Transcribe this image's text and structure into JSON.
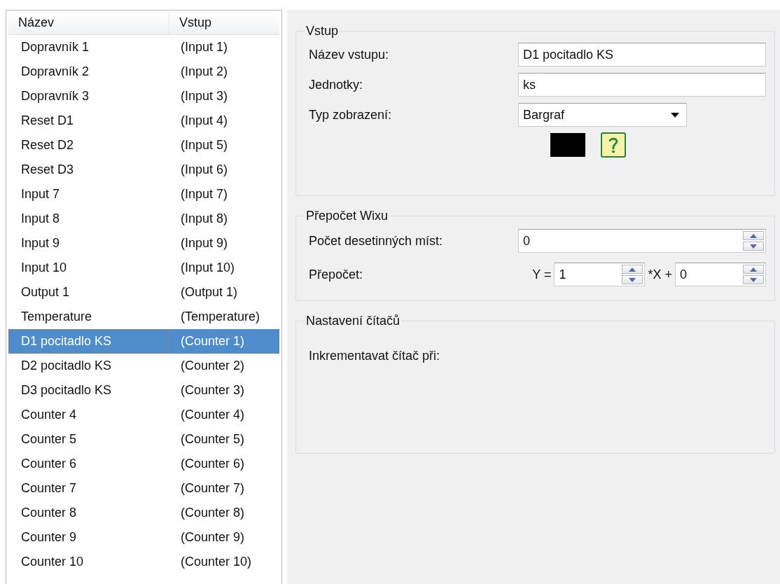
{
  "list": {
    "columns": [
      "Název",
      "Vstup"
    ],
    "rows": [
      {
        "name": "Dopravník 1",
        "input": "(Input 1)",
        "selected": false
      },
      {
        "name": "Dopravník 2",
        "input": "(Input 2)",
        "selected": false
      },
      {
        "name": "Dopravník 3",
        "input": "(Input 3)",
        "selected": false
      },
      {
        "name": "Reset D1",
        "input": "(Input 4)",
        "selected": false
      },
      {
        "name": "Reset D2",
        "input": "(Input 5)",
        "selected": false
      },
      {
        "name": "Reset D3",
        "input": "(Input 6)",
        "selected": false
      },
      {
        "name": "Input 7",
        "input": "(Input 7)",
        "selected": false
      },
      {
        "name": "Input 8",
        "input": "(Input 8)",
        "selected": false
      },
      {
        "name": "Input 9",
        "input": "(Input 9)",
        "selected": false
      },
      {
        "name": "Input 10",
        "input": "(Input 10)",
        "selected": false
      },
      {
        "name": "Output 1",
        "input": "(Output 1)",
        "selected": false
      },
      {
        "name": "Temperature",
        "input": "(Temperature)",
        "selected": false
      },
      {
        "name": "D1 pocitadlo KS",
        "input": "(Counter 1)",
        "selected": true
      },
      {
        "name": "D2 pocitadlo KS",
        "input": "(Counter 2)",
        "selected": false
      },
      {
        "name": "D3 pocitadlo KS",
        "input": "(Counter 3)",
        "selected": false
      },
      {
        "name": "Counter 4",
        "input": "(Counter 4)",
        "selected": false
      },
      {
        "name": "Counter 5",
        "input": "(Counter 5)",
        "selected": false
      },
      {
        "name": "Counter 6",
        "input": "(Counter 6)",
        "selected": false
      },
      {
        "name": "Counter 7",
        "input": "(Counter 7)",
        "selected": false
      },
      {
        "name": "Counter 8",
        "input": "(Counter 8)",
        "selected": false
      },
      {
        "name": "Counter 9",
        "input": "(Counter 9)",
        "selected": false
      },
      {
        "name": "Counter 10",
        "input": "(Counter 10)",
        "selected": false
      }
    ]
  },
  "input_group": {
    "title": "Vstup",
    "name_label": "Název vstupu:",
    "name_value": "D1 pocitadlo KS",
    "units_label": "Jednotky:",
    "units_value": "ks",
    "display_label": "Typ zobrazení:",
    "display_value": "Bargraf",
    "color": "#000000"
  },
  "conversion_group": {
    "title": "Přepočet Wixu",
    "decimals_label": "Počet desetinných míst:",
    "decimals_value": "0",
    "formula_label": "Přepočet:",
    "y_label": "Y =",
    "factor_value": "1",
    "x_label": "*X +",
    "offset_value": "0"
  },
  "counter_group": {
    "title": "Nastavení čítačů",
    "increment_label": "Inkrementavat čítač při:"
  }
}
